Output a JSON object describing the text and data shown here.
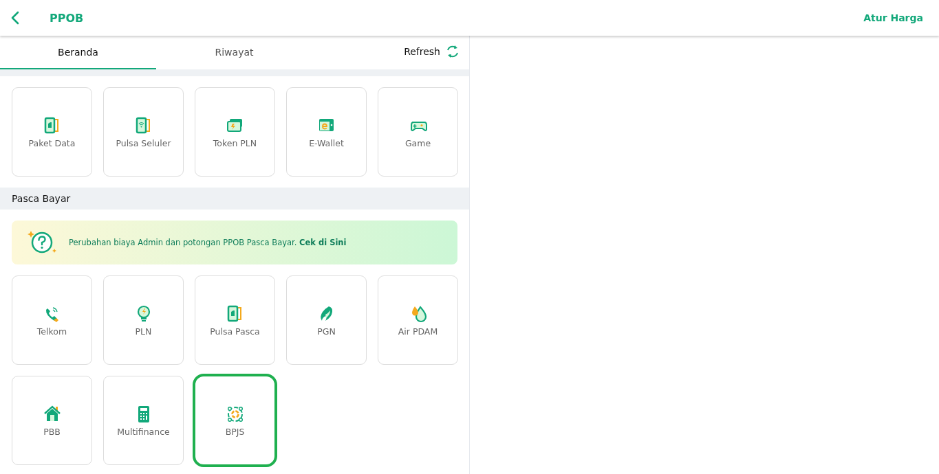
{
  "header": {
    "title": "PPOB",
    "action": "Atur Harga"
  },
  "tabs": [
    {
      "label": "Beranda",
      "selected": true
    },
    {
      "label": "Riwayat",
      "selected": false
    }
  ],
  "refresh": {
    "label": "Refresh"
  },
  "prabayar": {
    "tiles": [
      {
        "label": "Paket Data",
        "selected": false
      },
      {
        "label": "Pulsa Seluler",
        "selected": false
      },
      {
        "label": "Token PLN",
        "selected": false
      },
      {
        "label": "E-Wallet",
        "selected": false
      },
      {
        "label": "Game",
        "selected": false
      }
    ]
  },
  "pasca_bayar": {
    "title": "Pasca Bayar",
    "banner": {
      "text": "Perubahan biaya Admin dan potongan PPOB Pasca Bayar.",
      "link": "Cek di Sini"
    },
    "tiles": [
      {
        "label": "Telkom",
        "selected": false
      },
      {
        "label": "PLN",
        "selected": false
      },
      {
        "label": "Pulsa Pasca",
        "selected": false
      },
      {
        "label": "PGN",
        "selected": false
      },
      {
        "label": "Air PDAM",
        "selected": false
      },
      {
        "label": "PBB",
        "selected": false
      },
      {
        "label": "Multifinance",
        "selected": false
      },
      {
        "label": "BPJS",
        "selected": true
      }
    ]
  }
}
